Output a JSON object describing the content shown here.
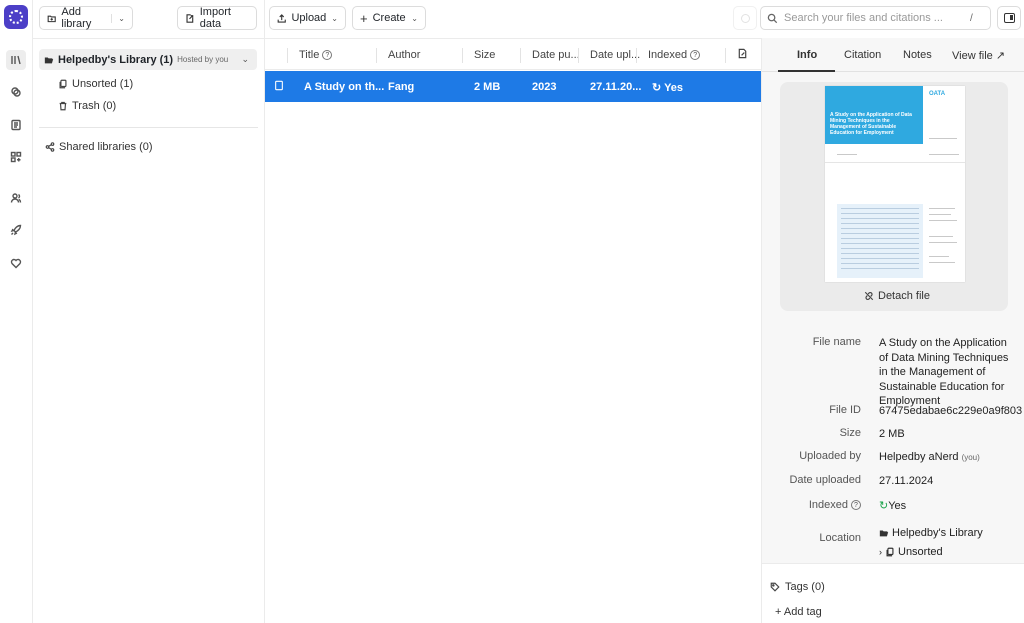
{
  "toolbar": {
    "add_library": "Add library",
    "import_data": "Import data",
    "upload": "Upload",
    "create": "Create",
    "search_placeholder": "Search your files and citations ...",
    "search_shortcut": "/"
  },
  "library": {
    "title": "Helpedby's Library (1)",
    "hosted": "Hosted by you",
    "items": [
      {
        "label": "Unsorted (1)"
      },
      {
        "label": "Trash (0)"
      }
    ],
    "shared": "Shared libraries (0)"
  },
  "table": {
    "columns": [
      "Title",
      "Author",
      "Size",
      "Date pu...",
      "Date upl...",
      "Indexed"
    ],
    "rows": [
      {
        "title": "A Study on th...",
        "author": "Fang",
        "size": "2 MB",
        "date_published": "2023",
        "date_uploaded": "27.11.20...",
        "indexed": "Yes"
      }
    ]
  },
  "info": {
    "tabs": [
      "Info",
      "Citation",
      "Notes",
      "View file"
    ],
    "preview": {
      "header_text": "A Study on the Application of Data Mining Techniques in the Management of Sustainable Education for Employment",
      "logo_text": "OATA"
    },
    "detach": "Detach file",
    "fields": {
      "file_name_label": "File name",
      "file_name": "A Study on the Application of Data Mining Techniques in the Management of Sustainable Education for Employment",
      "file_id_label": "File ID",
      "file_id": "67475edabae6c229e0a9f803",
      "size_label": "Size",
      "size": "2 MB",
      "uploaded_by_label": "Uploaded by",
      "uploaded_by": "Helpedby aNerd",
      "uploaded_by_you": "(you)",
      "date_uploaded_label": "Date uploaded",
      "date_uploaded": "27.11.2024",
      "indexed_label": "Indexed",
      "indexed": "Yes",
      "location_label": "Location",
      "location_library": "Helpedby's Library",
      "location_folder": "Unsorted"
    },
    "tags": "Tags (0)",
    "add_tag": "+ Add tag"
  },
  "colors": {
    "accent": "#1e7ae6",
    "brand": "#4c3fc7",
    "indexed_green": "#1aa34a"
  }
}
